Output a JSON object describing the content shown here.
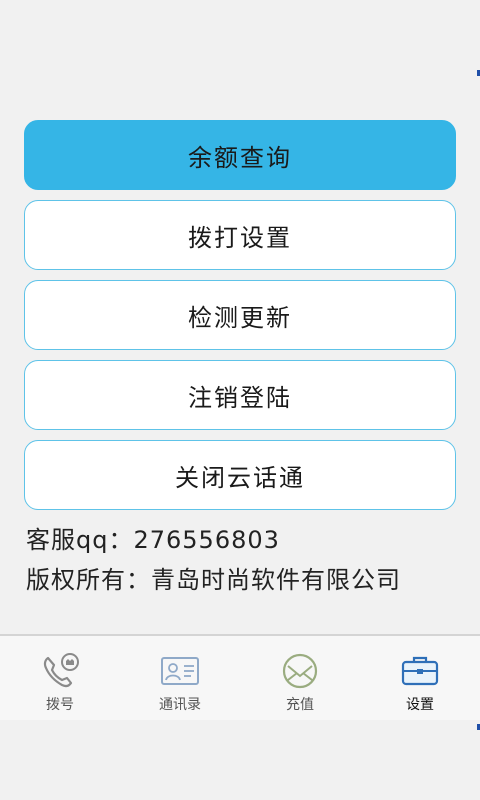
{
  "menu": {
    "items": [
      {
        "label": "余额查询",
        "active": true
      },
      {
        "label": "拨打设置",
        "active": false
      },
      {
        "label": "检测更新",
        "active": false
      },
      {
        "label": "注销登陆",
        "active": false
      },
      {
        "label": "关闭云话通",
        "active": false
      }
    ]
  },
  "info": {
    "customer_service": "客服qq：276556803",
    "copyright": "版权所有：青岛时尚软件有限公司"
  },
  "tabbar": {
    "tabs": [
      {
        "label": "拨号",
        "icon": "phone-icon"
      },
      {
        "label": "通讯录",
        "icon": "contact-card-icon"
      },
      {
        "label": "充值",
        "icon": "envelope-icon"
      },
      {
        "label": "设置",
        "icon": "briefcase-icon",
        "active": true
      }
    ]
  },
  "colors": {
    "accent": "#35b5e6",
    "button_border": "#5ec3e8",
    "background": "#f1f1f1"
  }
}
